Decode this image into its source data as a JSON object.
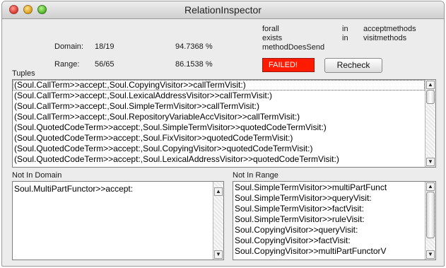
{
  "window": {
    "title": "RelationInspector"
  },
  "stats": {
    "domain_label": "Domain:",
    "domain_count": "18/19",
    "domain_pct": "94.7368 %",
    "range_label": "Range:",
    "range_count": "56/65",
    "range_pct": "86.1538 %"
  },
  "quantifiers": [
    {
      "q": "forall",
      "in": "in",
      "target": "acceptmethods"
    },
    {
      "q": "exists",
      "in": "in",
      "target": "visitmethods"
    },
    {
      "q": "methodDoesSend",
      "in": "",
      "target": ""
    }
  ],
  "status": {
    "failed_label": "FAILED!",
    "failed_color": "#ff1a00"
  },
  "buttons": {
    "recheck_label": "Recheck"
  },
  "tuples": {
    "label": "Tuples",
    "rows": [
      "(Soul.CallTerm>>accept:,Soul.CopyingVisitor>>callTermVisit:)",
      "(Soul.CallTerm>>accept:,Soul.LexicalAddressVisitor>>callTermVisit:)",
      "(Soul.CallTerm>>accept:,Soul.SimpleTermVisitor>>callTermVisit:)",
      "(Soul.CallTerm>>accept:,Soul.RepositoryVariableAccVisitor>>callTermVisit:)",
      "(Soul.QuotedCodeTerm>>accept:,Soul.SimpleTermVisitor>>quotedCodeTermVisit:)",
      "(Soul.QuotedCodeTerm>>accept:,Soul.FixVisitor>>quotedCodeTermVisit:)",
      "(Soul.QuotedCodeTerm>>accept:,Soul.CopyingVisitor>>quotedCodeTermVisit:)",
      "(Soul.QuotedCodeTerm>>accept:,Soul.LexicalAddressVisitor>>quotedCodeTermVisit:)"
    ]
  },
  "not_in_domain": {
    "label": "Not In Domain",
    "rows": [
      "Soul.MultiPartFunctor>>accept:"
    ]
  },
  "not_in_range": {
    "label": "Not In Range",
    "rows": [
      "Soul.SimpleTermVisitor>>multiPartFunct",
      "Soul.SimpleTermVisitor>>queryVisit:",
      "Soul.SimpleTermVisitor>>factVisit:",
      "Soul.SimpleTermVisitor>>ruleVisit:",
      "Soul.CopyingVisitor>>queryVisit:",
      "Soul.CopyingVisitor>>factVisit:",
      "Soul.CopyingVisitor>>multiPartFunctorV"
    ]
  },
  "icons": {
    "close": "close-icon",
    "minimize": "minimize-icon",
    "zoom": "zoom-icon",
    "up": "up-arrow-icon",
    "down": "down-arrow-icon"
  }
}
